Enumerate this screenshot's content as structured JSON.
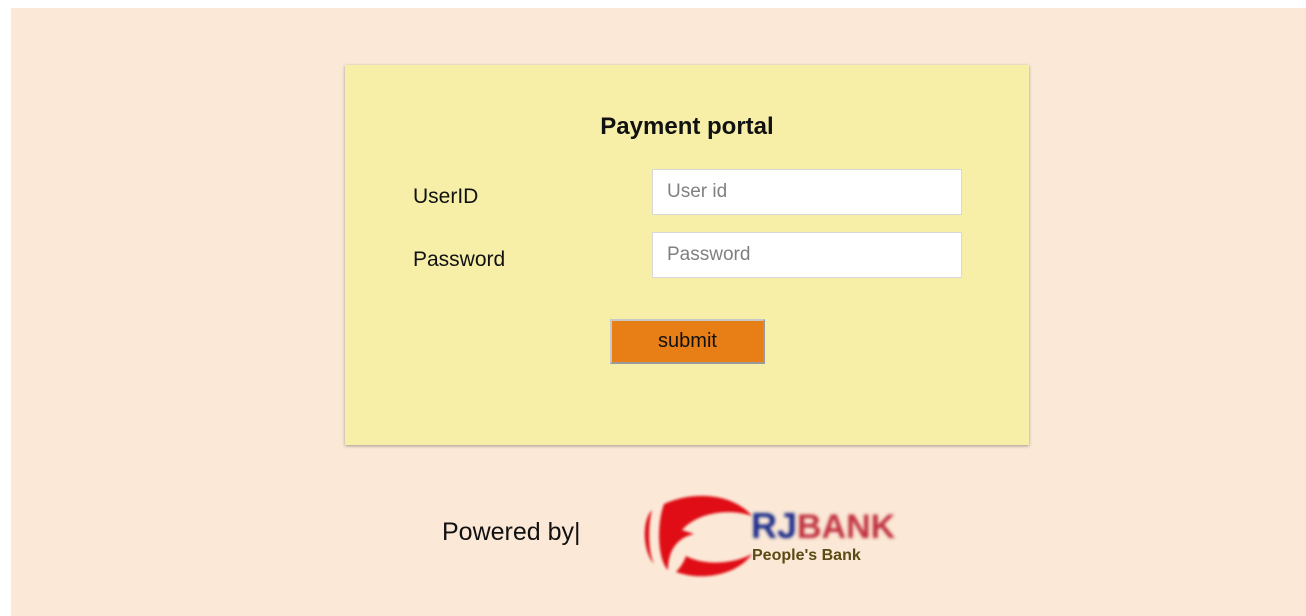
{
  "portal": {
    "title": "Payment portal"
  },
  "form": {
    "userid_label": "UserID",
    "userid_placeholder": "User id",
    "userid_value": "",
    "password_label": "Password",
    "password_placeholder": "Password",
    "password_value": "",
    "submit_label": "submit"
  },
  "footer": {
    "powered_by": "Powered by|",
    "logo": {
      "brand_rj": "RJ",
      "brand_bank": "BANK",
      "tagline": "People's Bank",
      "icon": "rjbank-logo-icon"
    }
  },
  "colors": {
    "page_background": "#fbe8d6",
    "card_background": "#f7efa8",
    "submit_button": "#e77f16",
    "logo_red": "#e01016",
    "logo_navy": "#1f2f8a",
    "tagline_olive": "#5a4a14"
  }
}
